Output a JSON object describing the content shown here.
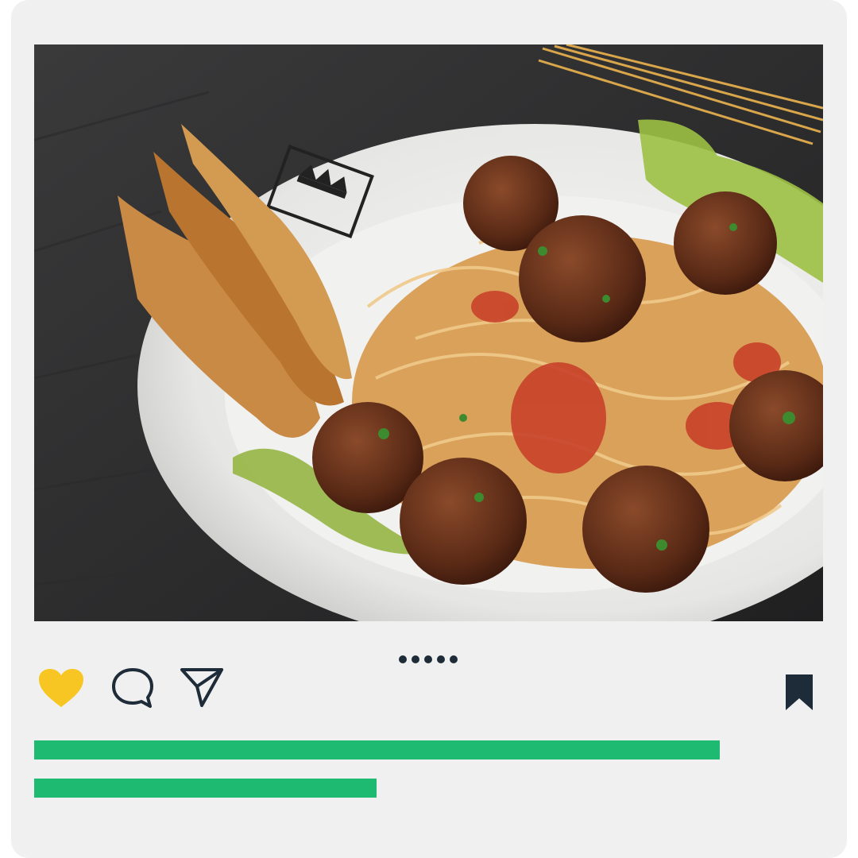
{
  "post": {
    "image": {
      "subject": "spaghetti-with-meatballs-photo"
    },
    "carousel": {
      "count": 5,
      "active_index": 0
    },
    "actions": {
      "like": {
        "icon": "heart-icon",
        "state": "liked",
        "color": "#f8c623"
      },
      "comment": {
        "icon": "speech-bubble-icon",
        "color": "#1e2b38"
      },
      "share": {
        "icon": "paper-plane-icon",
        "color": "#1e2b38"
      },
      "save": {
        "icon": "bookmark-icon",
        "state": "saved",
        "color": "#1e2b38"
      }
    },
    "caption_placeholder": {
      "color": "#1fba72",
      "lines": 2
    }
  },
  "colors": {
    "card_background": "#f0f0f0",
    "accent_green": "#1fba72",
    "dark_ink": "#1e2b38"
  }
}
